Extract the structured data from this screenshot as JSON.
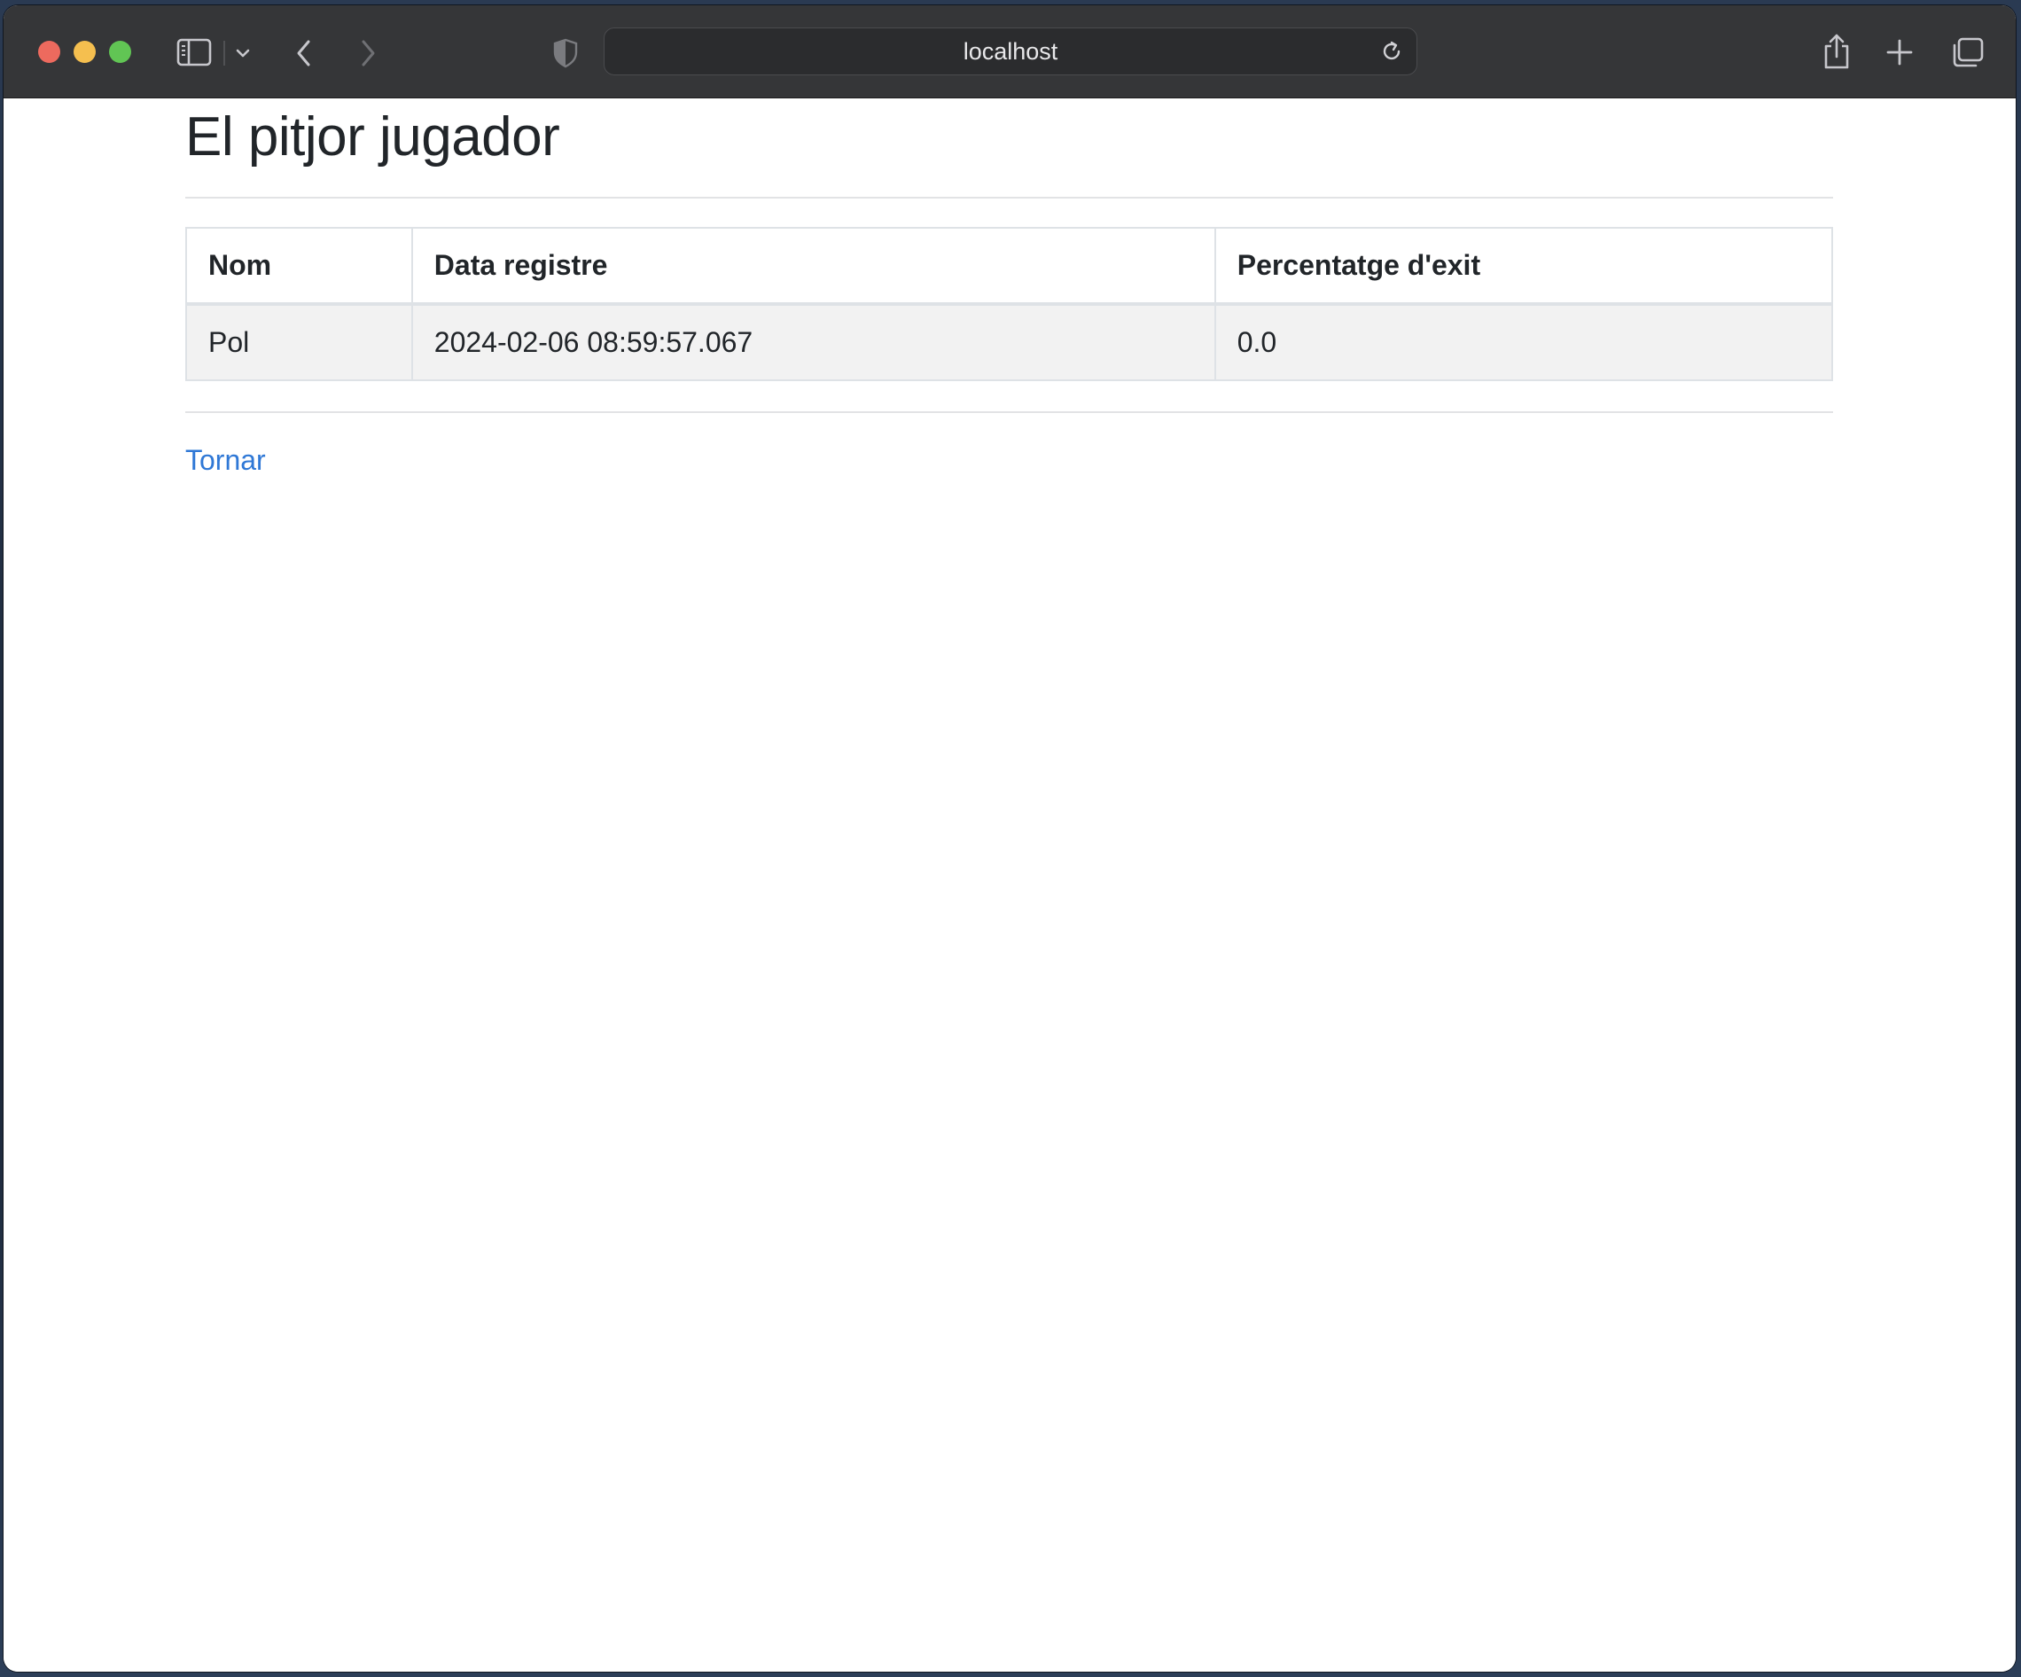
{
  "browser": {
    "address": "localhost"
  },
  "page": {
    "title": "El pitjor jugador",
    "table": {
      "headers": [
        "Nom",
        "Data registre",
        "Percentatge d'exit"
      ],
      "rows": [
        [
          "Pol",
          "2024-02-06 08:59:57.067",
          "0.0"
        ]
      ]
    },
    "back_link": "Tornar"
  },
  "icons": {
    "sidebar": "sidebar-icon",
    "sidebar_menu": "chevron-down-icon",
    "back": "chevron-left-icon",
    "forward": "chevron-right-icon",
    "privacy": "shield-icon",
    "reload": "reload-icon",
    "share": "share-icon",
    "new_tab": "plus-icon",
    "tabs_overview": "tabs-icon"
  },
  "colors": {
    "toolbar_bg": "#353638",
    "link": "#2f78d6",
    "traffic_close": "#ed6a5e",
    "traffic_minimize": "#f5bf4f",
    "traffic_maximize": "#61c554"
  }
}
